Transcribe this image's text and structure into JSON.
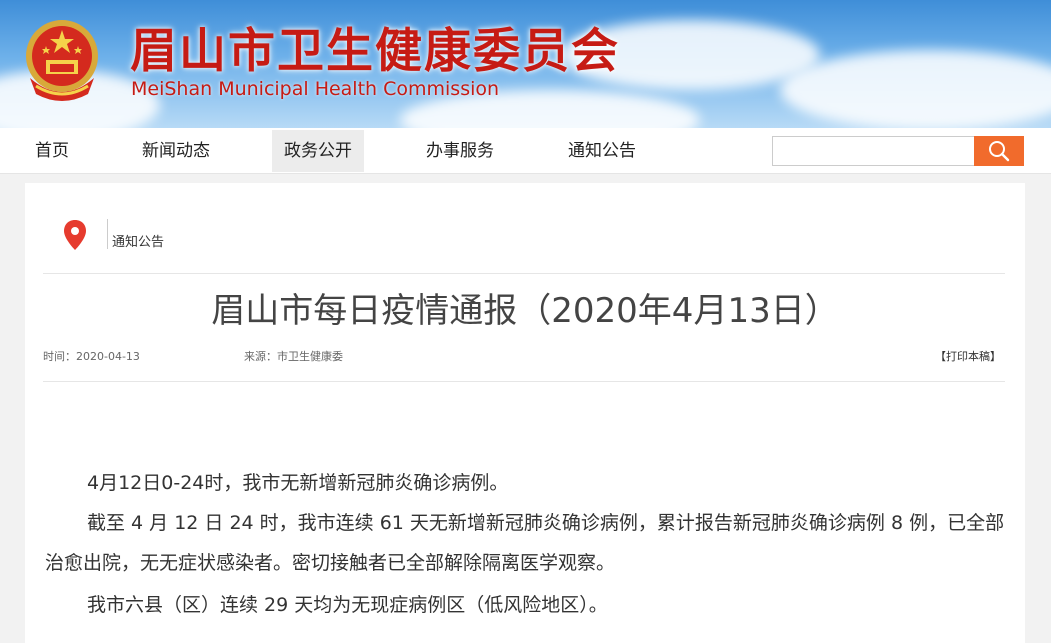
{
  "header": {
    "title": "眉山市卫生健康委员会",
    "subtitle": "MeiShan Municipal Health Commission",
    "emblem_icon": "national-emblem-icon",
    "title_color": "#c61b14"
  },
  "nav": {
    "items": [
      {
        "label": "首页"
      },
      {
        "label": "新闻动态"
      },
      {
        "label": "政务公开",
        "active": true
      },
      {
        "label": "办事服务"
      },
      {
        "label": "通知公告"
      }
    ],
    "search": {
      "value": "",
      "placeholder": "",
      "button_icon": "search-icon",
      "button_color": "#f16b2c"
    }
  },
  "breadcrumb": {
    "icon": "location-pin-icon",
    "label": "通知公告"
  },
  "article": {
    "title": "眉山市每日疫情通报（2020年4月13日）",
    "time": "时间：2020-04-13",
    "source": "来源：市卫生健康委",
    "print": "【打印本稿】",
    "paragraphs": [
      "4月12日0-24时，我市无新增新冠肺炎确诊病例。",
      "截至 4 月 12 日 24 时，我市连续 61 天无新增新冠肺炎确诊病例，累计报告新冠肺炎确诊病例 8 例，已全部治愈出院，无无症状感染者。密切接触者已全部解除隔离医学观察。",
      "我市六县（区）连续 29 天均为无现症病例区（低风险地区）。"
    ]
  }
}
